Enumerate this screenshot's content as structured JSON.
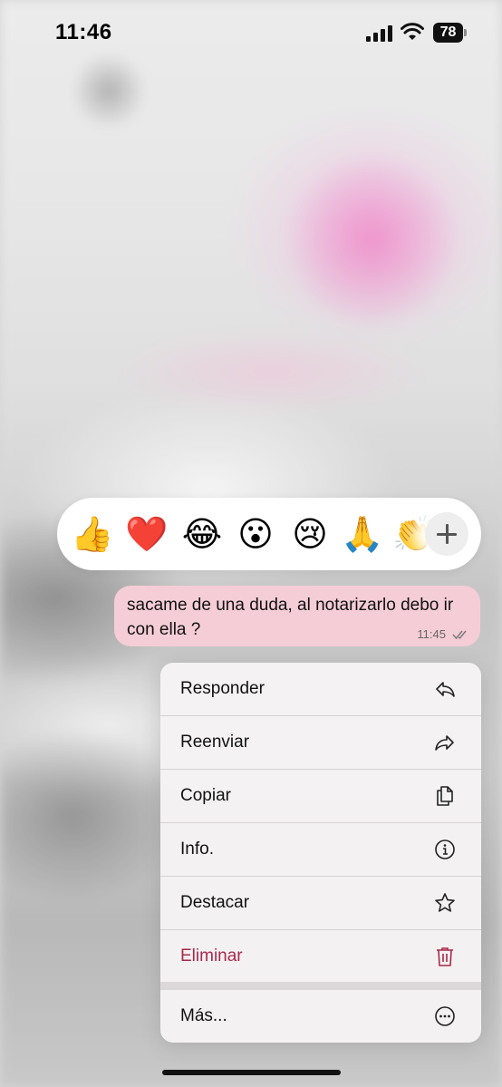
{
  "status_bar": {
    "time": "11:46",
    "battery": "78",
    "icons": [
      "signal-icon",
      "wifi-icon",
      "battery-icon"
    ]
  },
  "reactions": [
    {
      "emoji": "👍",
      "name": "thumbs-up"
    },
    {
      "emoji": "❤️",
      "name": "red-heart"
    },
    {
      "emoji": "😂",
      "name": "tears-of-joy"
    },
    {
      "emoji": "😮",
      "name": "surprised"
    },
    {
      "emoji": "😢",
      "name": "crying"
    },
    {
      "emoji": "🙏",
      "name": "folded-hands"
    },
    {
      "emoji": "👏",
      "name": "clapping-hands"
    }
  ],
  "reaction_more_icon": "plus-icon",
  "message": {
    "text": "sacame de una duda, al notarizarlo debo ir con ella ?",
    "time": "11:45",
    "status_icon": "double-check-icon",
    "bubble_color": "#f5cdd6"
  },
  "menu": {
    "items": [
      {
        "label": "Responder",
        "icon": "reply-icon"
      },
      {
        "label": "Reenviar",
        "icon": "forward-icon"
      },
      {
        "label": "Copiar",
        "icon": "copy-icon"
      },
      {
        "label": "Info.",
        "icon": "info-icon"
      },
      {
        "label": "Destacar",
        "icon": "star-icon"
      },
      {
        "label": "Eliminar",
        "icon": "trash-icon",
        "color": "#a8294a"
      }
    ],
    "more": {
      "label": "Más...",
      "icon": "more-icon"
    }
  }
}
